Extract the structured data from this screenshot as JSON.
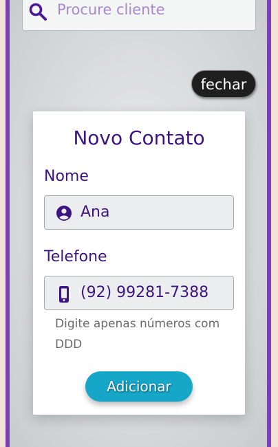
{
  "search": {
    "placeholder": "Procure cliente",
    "icon": "search-icon"
  },
  "close_button": {
    "label": "fechar"
  },
  "new_contact_form": {
    "title": "Novo Contato",
    "name_label": "Nome",
    "name_value": "Ana",
    "name_icon": "user-circle-icon",
    "phone_label": "Telefone",
    "phone_value": "(92) 99281-7388",
    "phone_icon": "mobile-phone-icon",
    "phone_hint": "Digite apenas números com DDD",
    "submit_label": "Adicionar"
  },
  "colors": {
    "accent": "#3c1580",
    "frame_border": "#7b3fb8",
    "button_primary": "#16a6c8",
    "button_dark": "#1e1e1e"
  }
}
